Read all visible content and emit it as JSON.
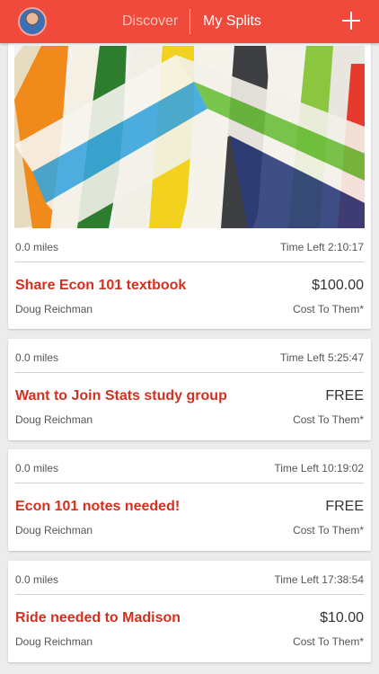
{
  "header": {
    "tabs": [
      {
        "label": "Discover",
        "active": false
      },
      {
        "label": "My Splits",
        "active": true
      }
    ],
    "add_icon": "plus-icon",
    "avatar_icon": "user-avatar",
    "accent_color": "#ef4a3c"
  },
  "cards": [
    {
      "miles": "0.0 miles",
      "time_left": "Time Left 2:10:17",
      "title": "Share Econ 101 textbook",
      "price": "$100.00",
      "owner": "Doug Reichman",
      "cost_label": "Cost To Them*",
      "has_image": true
    },
    {
      "miles": "0.0 miles",
      "time_left": "Time Left 5:25:47",
      "title": "Want to Join Stats study group",
      "price": "FREE",
      "owner": "Doug Reichman",
      "cost_label": "Cost To Them*",
      "has_image": false
    },
    {
      "miles": "0.0 miles",
      "time_left": "Time Left 10:19:02",
      "title": "Econ 101 notes needed!",
      "price": "FREE",
      "owner": "Doug Reichman",
      "cost_label": "Cost To Them*",
      "has_image": false
    },
    {
      "miles": "0.0 miles",
      "time_left": "Time Left 17:38:54",
      "title": "Ride needed to Madison",
      "price": "$10.00",
      "owner": "Doug Reichman",
      "cost_label": "Cost To Them*",
      "has_image": false
    }
  ]
}
